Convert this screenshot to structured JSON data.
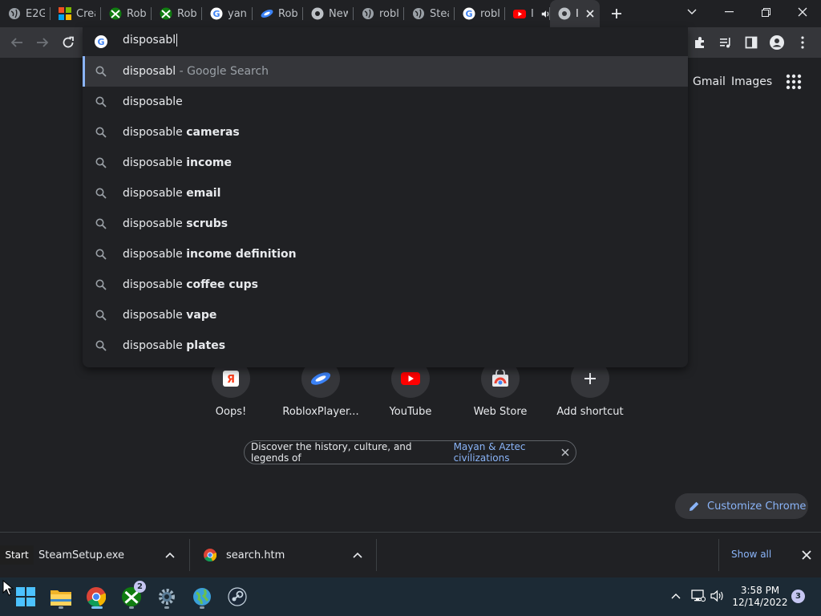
{
  "tabs": [
    {
      "label": "E2G",
      "icon": "globe-icon"
    },
    {
      "label": "Crea",
      "icon": "microsoft-icon"
    },
    {
      "label": "Rob",
      "icon": "xbox-icon"
    },
    {
      "label": "Rob",
      "icon": "xbox-icon"
    },
    {
      "label": "yan",
      "icon": "google-icon"
    },
    {
      "label": "Rob",
      "icon": "roblox-player-icon"
    },
    {
      "label": "New",
      "icon": "chrome-icon"
    },
    {
      "label": "robl",
      "icon": "globe-icon"
    },
    {
      "label": "Stea",
      "icon": "globe-icon"
    },
    {
      "label": "robl",
      "icon": "google-icon"
    },
    {
      "label": "I",
      "icon": "youtube-icon"
    },
    {
      "label": "I",
      "icon": "chrome-icon"
    }
  ],
  "omnibox": {
    "value": "disposabl",
    "suggestions": [
      {
        "prefix": "disposabl",
        "bold": "",
        "suffix": " - Google Search"
      },
      {
        "prefix": "disposable",
        "bold": "",
        "suffix": ""
      },
      {
        "prefix": "disposable ",
        "bold": "cameras",
        "suffix": ""
      },
      {
        "prefix": "disposable ",
        "bold": "income",
        "suffix": ""
      },
      {
        "prefix": "disposable ",
        "bold": "email",
        "suffix": ""
      },
      {
        "prefix": "disposable ",
        "bold": "scrubs",
        "suffix": ""
      },
      {
        "prefix": "disposable ",
        "bold": "income definition",
        "suffix": ""
      },
      {
        "prefix": "disposable ",
        "bold": "coffee cups",
        "suffix": ""
      },
      {
        "prefix": "disposable ",
        "bold": "vape",
        "suffix": ""
      },
      {
        "prefix": "disposable ",
        "bold": "plates",
        "suffix": ""
      }
    ]
  },
  "page": {
    "gmail": "Gmail",
    "images": "Images",
    "shortcuts": [
      {
        "label": "Oops!",
        "icon": "yandex-icon"
      },
      {
        "label": "RobloxPlayer...",
        "icon": "roblox-player-icon"
      },
      {
        "label": "YouTube",
        "icon": "youtube-icon"
      },
      {
        "label": "Web Store",
        "icon": "web-store-icon"
      },
      {
        "label": "Add shortcut",
        "icon": "plus-icon"
      }
    ],
    "promo_text": "Discover the history, culture, and legends of",
    "promo_link": "Mayan & Aztec civilizations",
    "customize": "Customize Chrome"
  },
  "downloads": {
    "start_tooltip": "Start",
    "items": [
      {
        "name": "SteamSetup.exe"
      },
      {
        "name": "search.htm"
      }
    ],
    "show_all": "Show all"
  },
  "taskbar": {
    "xbox_badge": "2",
    "time": "3:58 PM",
    "date": "12/14/2022",
    "notifications": "3"
  },
  "colors": {
    "accent": "#8ab4f8",
    "background": "#202124",
    "toolbar": "#35363a",
    "taskbar": "#1c2a35"
  }
}
